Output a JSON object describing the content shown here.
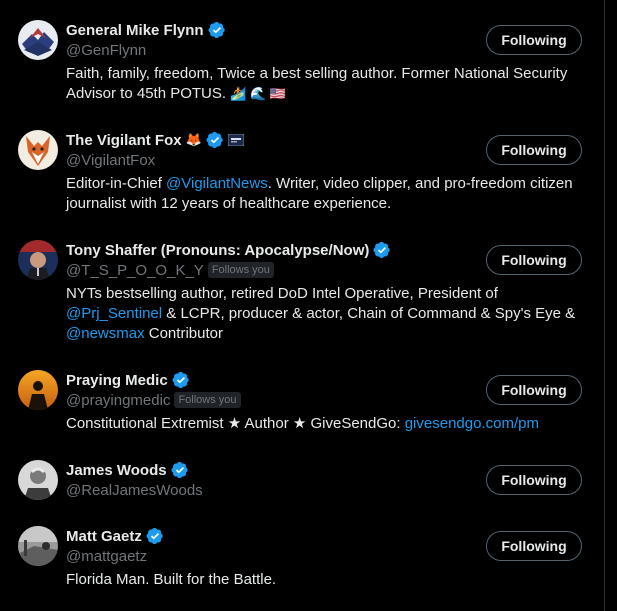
{
  "accounts": [
    {
      "name": "General Mike Flynn",
      "handle": "@GenFlynn",
      "follows_you": "",
      "button": "Following",
      "bio_parts": [
        "Faith, family, freedom, Twice a best selling author. Former National Security Advisor to 45th POTUS. ",
        "🏄 🌊 🇺🇸"
      ]
    },
    {
      "name": "The Vigilant Fox",
      "name_emojis": "🦊",
      "handle": "@VigilantFox",
      "follows_you": "",
      "button": "Following",
      "bio_before": "Editor-in-Chief ",
      "bio_link": "@VigilantNews",
      "bio_after": ". Writer, video clipper, and pro-freedom citizen journalist with 12 years of healthcare experience."
    },
    {
      "name": "Tony Shaffer (Pronouns: Apocalypse/Now)",
      "handle": "@T_S_P_O_O_K_Y",
      "follows_you": "Follows you",
      "button": "Following",
      "bio_1": "NYTs bestselling author, retired DoD Intel Operative, President of ",
      "bio_link_1": "@Prj_Sentinel",
      "bio_2": " & LCPR, producer & actor, Chain of Command & Spy's Eye & ",
      "bio_link_2": "@newsmax",
      "bio_3": " Contributor"
    },
    {
      "name": "Praying Medic",
      "handle": "@prayingmedic",
      "follows_you": "Follows you",
      "button": "Following",
      "bio_before": "Constitutional Extremist ★ Author ★ GiveSendGo: ",
      "bio_link": "givesendgo.com/pm"
    },
    {
      "name": "James Woods",
      "handle": "@RealJamesWoods",
      "follows_you": "",
      "button": "Following",
      "bio": ""
    },
    {
      "name": "Matt Gaetz",
      "handle": "@mattgaetz",
      "follows_you": "",
      "button": "Following",
      "bio": "Florida Man. Built for the Battle."
    }
  ],
  "colors": {
    "background": "#000000",
    "text": "#e7e9ea",
    "secondary": "#71767b",
    "link": "#1d9bf0",
    "verified": "#1d9bf0"
  }
}
